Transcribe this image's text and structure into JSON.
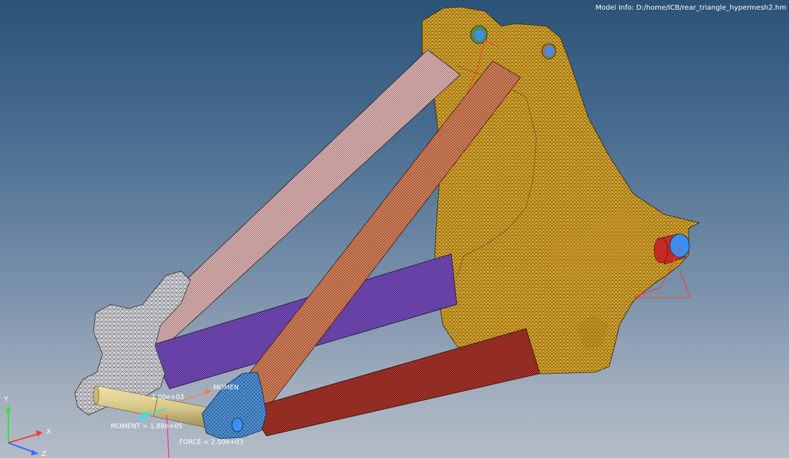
{
  "model_info": {
    "prefix": "Model Info: ",
    "path": "D:/home/ICB/rear_triangle_hypermesh2.hm"
  },
  "annotations": {
    "moment_upper": "MOMEN",
    "moment_upper_value": "1.00e+03",
    "moment_lower": "MOMENT = 1.88e+05",
    "force": "FORCE = 2.50e+03"
  },
  "triad": {
    "x": "X",
    "y": "Y",
    "z": "Z"
  },
  "colors": {
    "frame_block": "#d9a62e",
    "seat_stay": "#e6bcbc",
    "chain_stay_purple": "#7b4fc2",
    "strut_orange": "#d7815c",
    "bottom_tube": "#b1382d",
    "dropout": "#d2d2d6",
    "dropout_blue": "#4e91d6",
    "axle": "#d8c88a",
    "bearing_blue": "#3e8ef0",
    "bearing_red": "#e0312b",
    "constraint_red": "#ff3a2a",
    "moment_cyan": "#2ee6ee",
    "force_magenta": "#ff2ea0",
    "moment_orange": "#ff7a3c"
  }
}
